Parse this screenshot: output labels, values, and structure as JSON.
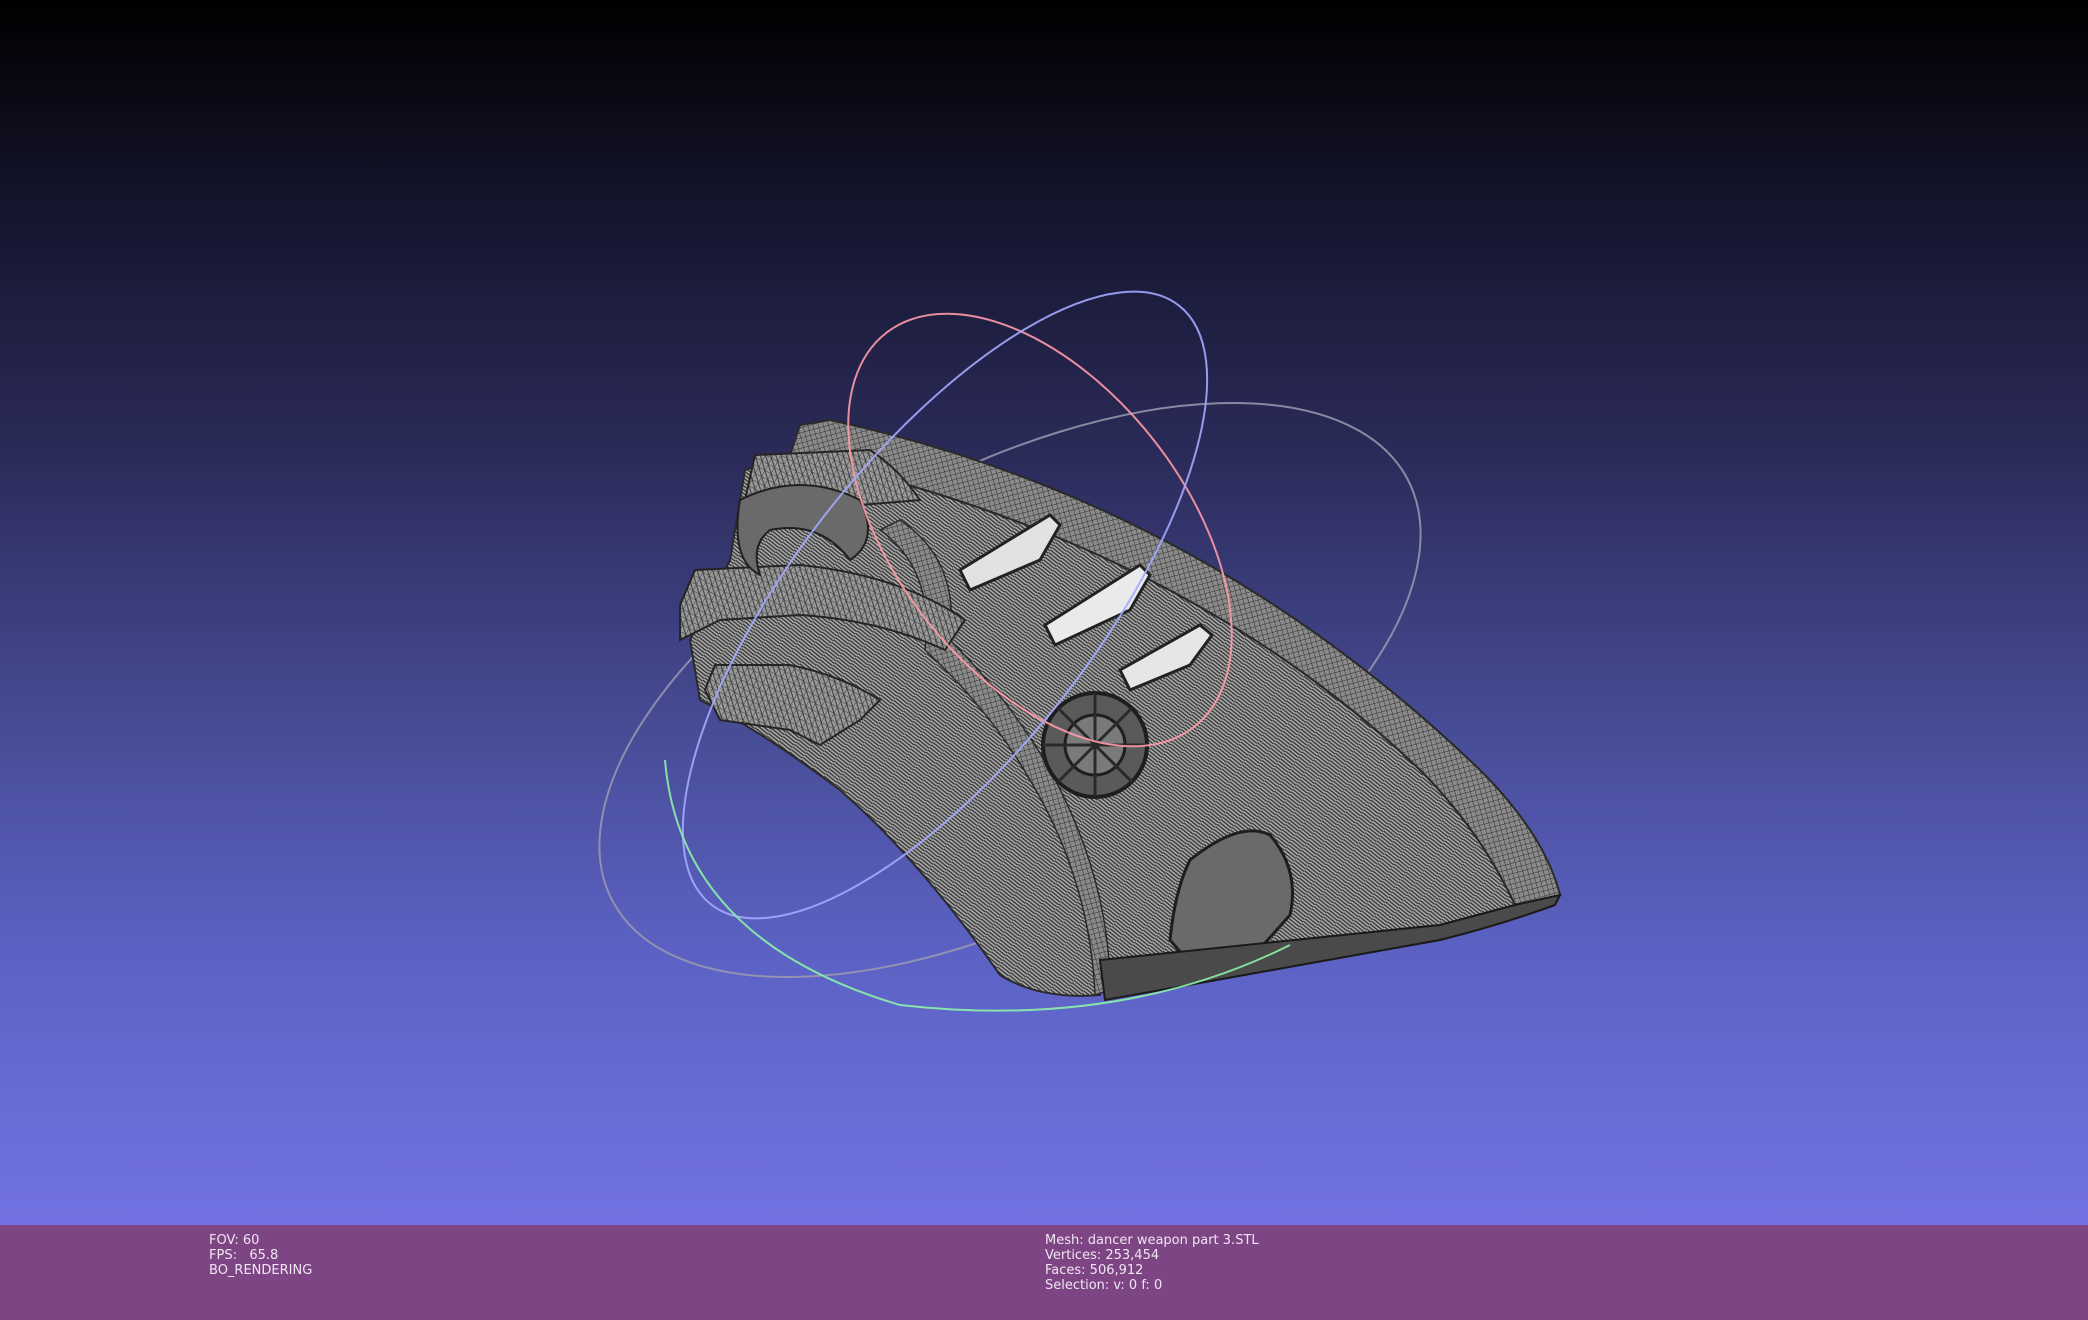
{
  "viewport": {
    "mesh_color": "#8f8f8f",
    "wire_color": "#3a3a3a",
    "trackball_colors": [
      "#ff9aa8",
      "#9aa0ff",
      "#8cf0a8",
      "#a0a0a0"
    ]
  },
  "status_left": {
    "fov": "FOV: 60",
    "fps": "FPS:   65.8",
    "mode": "BO_RENDERING"
  },
  "status_right": {
    "mesh": "Mesh: dancer weapon part 3.STL",
    "vertices": "Vertices: 253,454",
    "faces": "Faces: 506,912",
    "selection": "Selection: v: 0 f: 0"
  }
}
